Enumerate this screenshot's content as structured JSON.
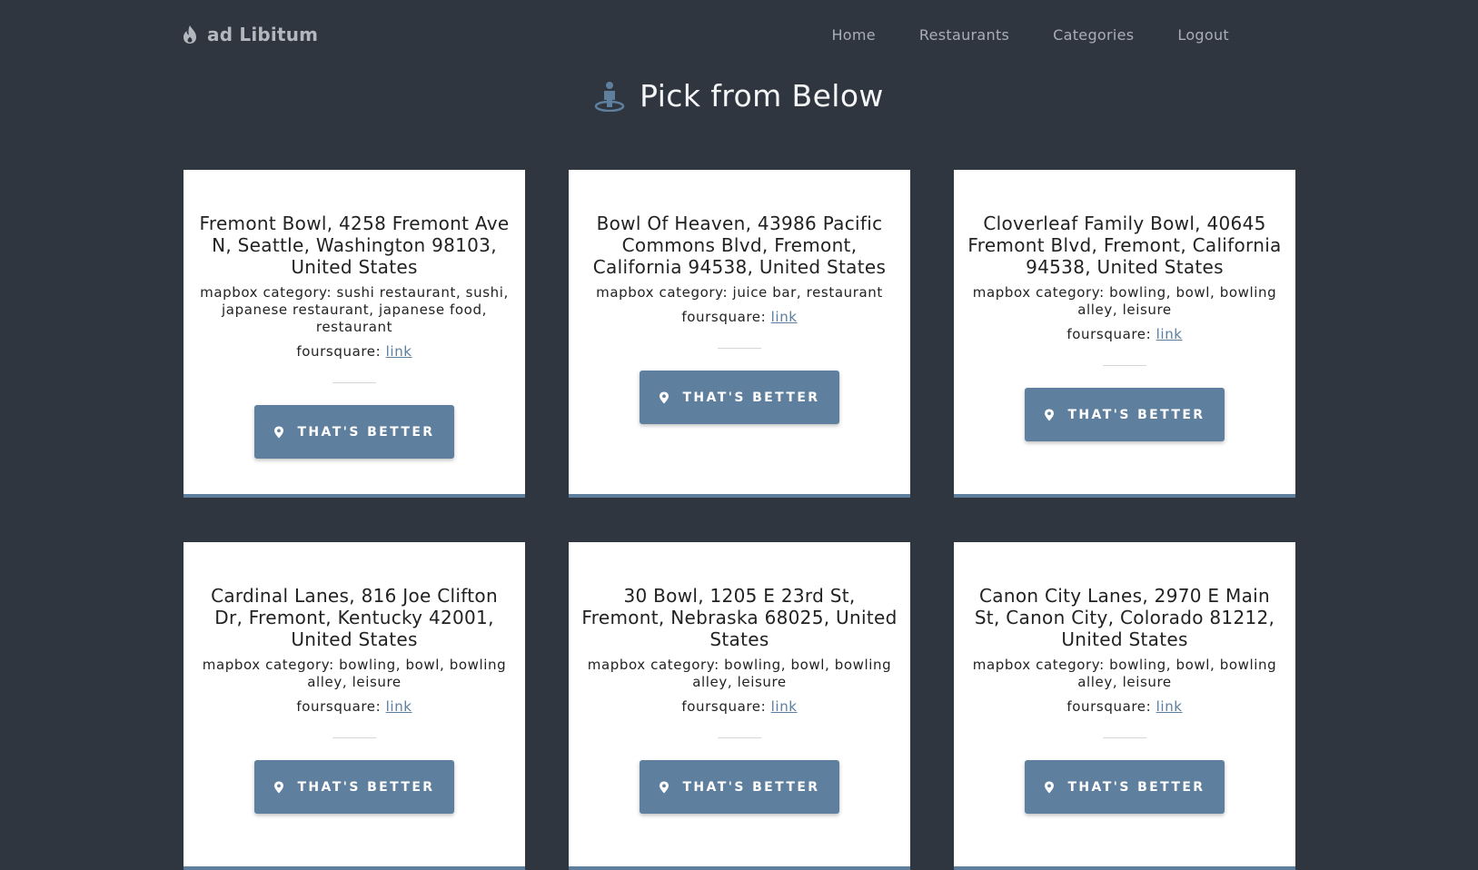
{
  "nav": {
    "brand": "ad Libitum",
    "links": [
      "Home",
      "Restaurants",
      "Categories",
      "Logout"
    ]
  },
  "heading": "Pick from Below",
  "cards": [
    {
      "title": "Fremont Bowl, 4258 Fremont Ave N, Seattle, Washington 98103, United States",
      "category": "mapbox category: sushi restaurant, sushi, japanese restaurant, japanese food, restaurant",
      "fs_label": "foursquare: ",
      "fs_link": "link",
      "button": "THAT'S BETTER"
    },
    {
      "title": "Bowl Of Heaven, 43986 Pacific Commons Blvd, Fremont, California 94538, United States",
      "category": "mapbox category: juice bar, restaurant",
      "fs_label": "foursquare: ",
      "fs_link": "link",
      "button": "THAT'S BETTER"
    },
    {
      "title": "Cloverleaf Family Bowl, 40645 Fremont Blvd, Fremont, California 94538, United States",
      "category": "mapbox category: bowling, bowl, bowling alley, leisure",
      "fs_label": "foursquare: ",
      "fs_link": "link",
      "button": "THAT'S BETTER"
    },
    {
      "title": "Cardinal Lanes, 816 Joe Clifton Dr, Fremont, Kentucky 42001, United States",
      "category": "mapbox category: bowling, bowl, bowling alley, leisure",
      "fs_label": "foursquare: ",
      "fs_link": "link",
      "button": "THAT'S BETTER"
    },
    {
      "title": "30 Bowl, 1205 E 23rd St, Fremont, Nebraska 68025, United States",
      "category": "mapbox category: bowling, bowl, bowling alley, leisure",
      "fs_label": "foursquare: ",
      "fs_link": "link",
      "button": "THAT'S BETTER"
    },
    {
      "title": "Canon City Lanes, 2970 E Main St, Canon City, Colorado 81212, United States",
      "category": "mapbox category: bowling, bowl, bowling alley, leisure",
      "fs_label": "foursquare: ",
      "fs_link": "link",
      "button": "THAT'S BETTER"
    }
  ],
  "icons": {
    "brand": "flame-icon",
    "heading": "person-pin-icon",
    "button": "map-pin-icon"
  },
  "colors": {
    "background": "#2f3640",
    "accent": "#5f7f9e",
    "card": "#ffffff",
    "link": "#5a7ea0"
  }
}
